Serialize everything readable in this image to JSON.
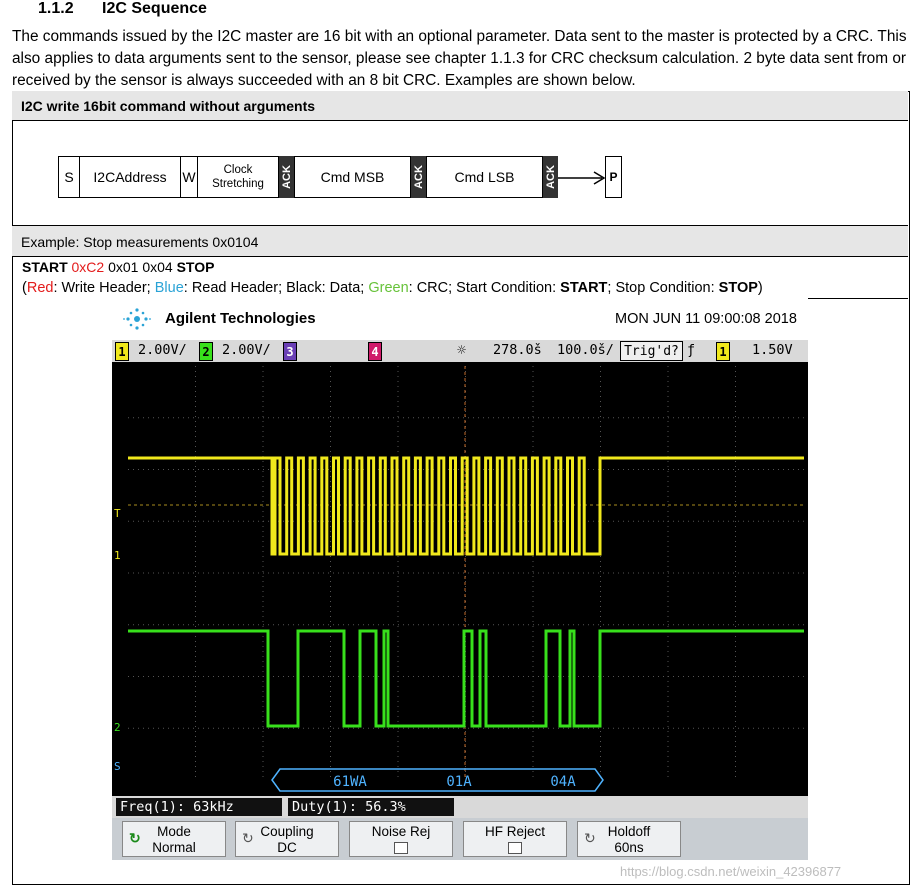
{
  "section": {
    "number": "1.1.2",
    "title": "I2C Sequence"
  },
  "intro": "The commands issued by the I2C master are 16 bit with an optional parameter. Data sent to the master is protected by a CRC. This also applies to data arguments sent to the sensor, please see chapter 1.1.3 for CRC checksum calculation. 2 byte data sent from or received by the sensor is always succeeded with an 8 bit CRC. Examples are shown below.",
  "table": {
    "header": "I2C write 16bit command without arguments",
    "example": "Example: Stop measurements 0x0104"
  },
  "sequence": {
    "s": "S",
    "address": "I2CAddress",
    "w": "W",
    "clock_line1": "Clock",
    "clock_line2": "Stretching",
    "ack": "ACK",
    "cmd_msb": "Cmd MSB",
    "cmd_lsb": "Cmd LSB",
    "p": "P"
  },
  "start_line": {
    "start": "START",
    "addr": "0xC2",
    "data": " 0x01 0x04 ",
    "stop": "STOP"
  },
  "legend": {
    "open": "(",
    "red": "Red",
    "t1": ": Write Header; ",
    "blue": "Blue",
    "t2": ": Read Header; Black: Data; ",
    "green": "Green",
    "t3": ": CRC; Start Condition: ",
    "start": "START",
    "t4": "; Stop Condition: ",
    "stop": "STOP",
    "close": ")"
  },
  "scope": {
    "brand": "Agilent Technologies",
    "datetime": "MON JUN 11 09:00:08 2018",
    "status": {
      "ch1_num": "1",
      "ch1_scale": "2.00V/",
      "ch2_num": "2",
      "ch2_scale": "2.00V/",
      "ch3_num": "3",
      "ch4_num": "4",
      "time_pos": "278.0š",
      "time_scale": "100.0š/",
      "trig": "Trig'd?",
      "trig_ch": "1",
      "trig_level": "1.50V"
    },
    "markers": {
      "ch1": "1",
      "ch2": "2",
      "t": "T",
      "s": "S"
    },
    "decode": [
      "61WA",
      "01A",
      "04A"
    ],
    "measurements": {
      "freq": "Freq(1): 63kHz",
      "duty": "Duty(1): 56.3%"
    },
    "softkeys": [
      {
        "line1": "Mode",
        "line2": "Normal"
      },
      {
        "line1": "Coupling",
        "line2": "DC"
      },
      {
        "line1": "Noise Rej",
        "line2": ""
      },
      {
        "line1": "HF Reject",
        "line2": ""
      },
      {
        "line1": "Holdoff",
        "line2": "60ns"
      }
    ],
    "colors": {
      "ch1": "#f0e81c",
      "ch2": "#38e01c",
      "ch3": "#6a3fb5",
      "ch4": "#d01b6a",
      "decode": "#4fb3ff"
    }
  },
  "watermark": "https://blog.csdn.net/weixin_42396877"
}
